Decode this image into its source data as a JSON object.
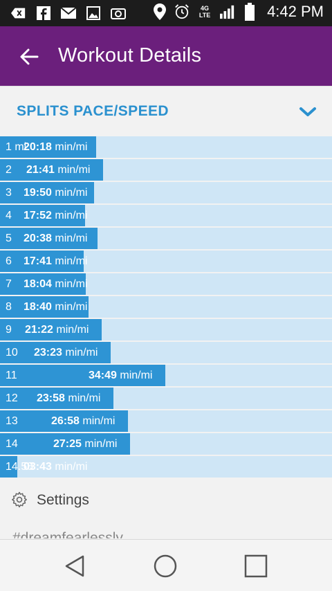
{
  "status_bar": {
    "time": "4:42 PM",
    "network": "4G LTE",
    "icons": [
      "back-bubble-icon",
      "facebook-icon",
      "mail-icon",
      "image-icon",
      "camera-icon",
      "location-pin-icon",
      "alarm-icon",
      "network-icon",
      "signal-icon",
      "battery-icon"
    ]
  },
  "app_bar": {
    "title": "Workout Details",
    "back_icon": "back-arrow-icon",
    "color": "#6b1f7c"
  },
  "splits_section": {
    "title": "SPLITS PACE/SPEED",
    "toggle_icon": "chevron-down-icon",
    "accent_color": "#2b91cf",
    "bar_color": "#2e94d4",
    "track_color": "#cfe6f6",
    "max_pace_minutes": 70.0,
    "rows": [
      {
        "label": "1 mi",
        "pace": "20:18",
        "unit": "min/mi"
      },
      {
        "label": "2",
        "pace": "21:41",
        "unit": "min/mi"
      },
      {
        "label": "3",
        "pace": "19:50",
        "unit": "min/mi"
      },
      {
        "label": "4",
        "pace": "17:52",
        "unit": "min/mi"
      },
      {
        "label": "5",
        "pace": "20:38",
        "unit": "min/mi"
      },
      {
        "label": "6",
        "pace": "17:41",
        "unit": "min/mi"
      },
      {
        "label": "7",
        "pace": "18:04",
        "unit": "min/mi"
      },
      {
        "label": "8",
        "pace": "18:40",
        "unit": "min/mi"
      },
      {
        "label": "9",
        "pace": "21:22",
        "unit": "min/mi"
      },
      {
        "label": "10",
        "pace": "23:23",
        "unit": "min/mi"
      },
      {
        "label": "11",
        "pace": "34:49",
        "unit": "min/mi"
      },
      {
        "label": "12",
        "pace": "23:58",
        "unit": "min/mi"
      },
      {
        "label": "13",
        "pace": "26:58",
        "unit": "min/mi"
      },
      {
        "label": "14",
        "pace": "27:25",
        "unit": "min/mi"
      },
      {
        "label": "14.58",
        "pace": "03:43",
        "unit": "min/mi"
      }
    ]
  },
  "settings": {
    "label": "Settings",
    "icon": "gear-icon"
  },
  "hashtag": "#dreamfearlessly",
  "nav_bar": {
    "buttons": [
      "back-triangle-icon",
      "home-circle-icon",
      "recents-square-icon"
    ]
  }
}
